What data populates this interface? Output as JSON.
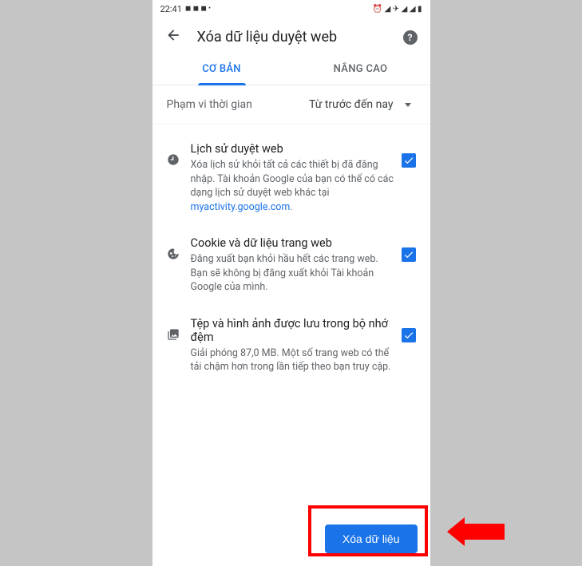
{
  "status": {
    "time": "22:41",
    "left_icons": "◼ ◼ ◼ •",
    "right_icons": "⏰ ◢ ✈ ◢ ◢ ▮"
  },
  "header": {
    "title": "Xóa dữ liệu duyệt web"
  },
  "tabs": {
    "basic": "CƠ BẢN",
    "advanced": "NÂNG CAO"
  },
  "timeRange": {
    "label": "Phạm vi thời gian",
    "value": "Từ trước đến nay"
  },
  "options": [
    {
      "title": "Lịch sử duyệt web",
      "desc_before": "Xóa lịch sử khỏi tất cả các thiết bị đã đăng nhập. Tài khoản Google của bạn có thể có các dạng lịch sử duyệt web khác tại ",
      "link": "myactivity.google.com",
      "desc_after": ".",
      "checked": true
    },
    {
      "title": "Cookie và dữ liệu trang web",
      "desc_before": "Đăng xuất bạn khỏi hầu hết các trang web. Bạn sẽ không bị đăng xuất khỏi Tài khoản Google của mình.",
      "link": "",
      "desc_after": "",
      "checked": true
    },
    {
      "title": "Tệp và hình ảnh được lưu trong bộ nhớ đệm",
      "desc_before": "Giải phóng 87,0 MB. Một số trang web có thể tải chậm hơn trong lần tiếp theo bạn truy cập.",
      "link": "",
      "desc_after": "",
      "checked": true
    }
  ],
  "footer": {
    "clear_label": "Xóa dữ liệu"
  }
}
